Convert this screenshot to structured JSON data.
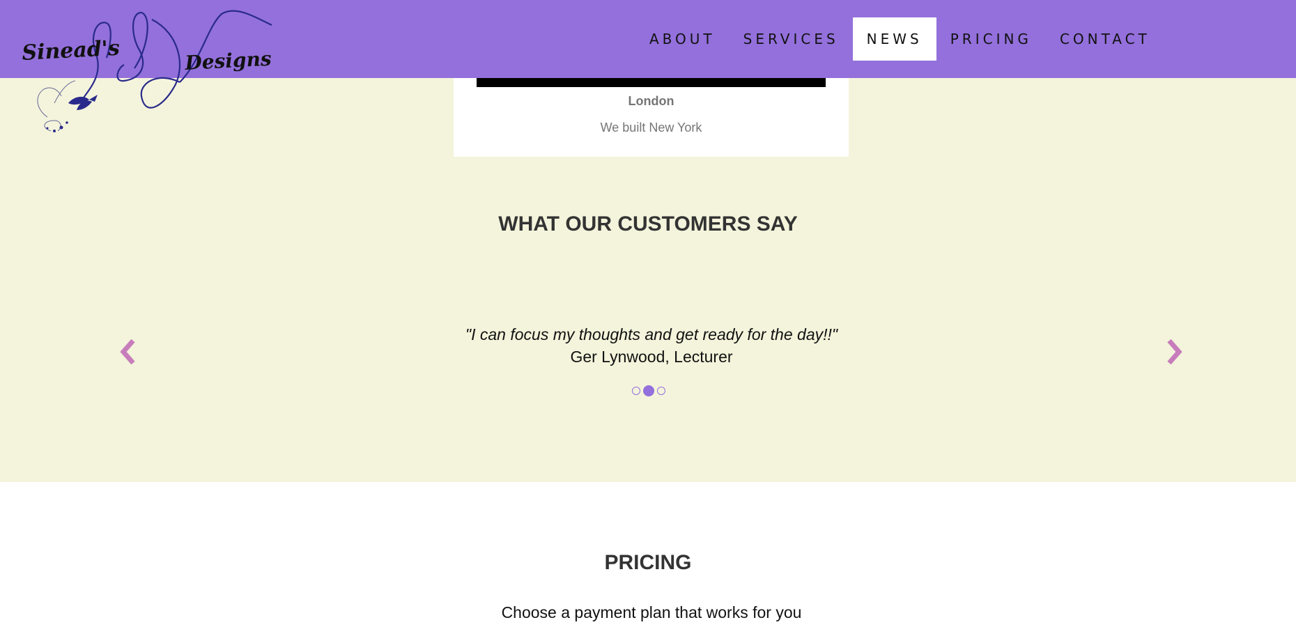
{
  "logo": {
    "text_line1": "Sinead's",
    "text_line2": "Designs"
  },
  "nav": {
    "items": [
      {
        "label": "ABOUT"
      },
      {
        "label": "SERVICES"
      },
      {
        "label": "NEWS",
        "active": true
      },
      {
        "label": "PRICING"
      },
      {
        "label": "CONTACT"
      }
    ]
  },
  "news_card": {
    "title": "London",
    "text": "We built New York"
  },
  "testimonials": {
    "heading": "WHAT OUR CUSTOMERS SAY",
    "quote": "\"I can focus my thoughts and get ready for the day!!\"",
    "author": "Ger Lynwood, Lecturer",
    "slide_count": 3,
    "active_slide": 2
  },
  "pricing": {
    "heading": "PRICING",
    "subtitle": "Choose a payment plan that works for you"
  },
  "colors": {
    "header_bg": "#9370db",
    "section_bg": "#f4f4dc",
    "arrow": "#c77dbb",
    "logo_ink": "#2a2a8c"
  },
  "icons": {
    "prev": "chevron-left-icon",
    "next": "chevron-right-icon"
  }
}
